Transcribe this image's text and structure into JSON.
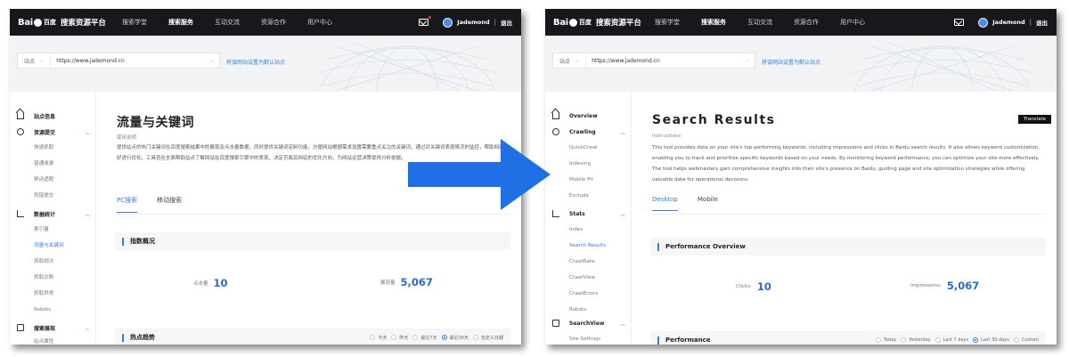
{
  "colors": {
    "topbar": "#18181c",
    "accent": "#3b7ddd",
    "arrow": "#1f6fe5",
    "metric": "#2a6ac9"
  },
  "cn": {
    "logo": "Bai",
    "logo_suffix": "百度",
    "platform": "搜索资源平台",
    "topnav": [
      "搜索学堂",
      "搜索服务",
      "互动交流",
      "资源合作",
      "用户中心"
    ],
    "active_nav": 1,
    "user": "Jademond",
    "logout": "退出",
    "site_prefix": "站点",
    "site_url": "https://www.jademond.cn",
    "set_default": "将该网站设置为默认站点",
    "sidebar": {
      "overview": "站点信息",
      "crawl_group": "资源提交",
      "crawl_items": [
        "快速抓取",
        "普通收录",
        "移动适配",
        "死链提交"
      ],
      "stats_group": "数据统计",
      "stats_items": [
        "索引量",
        "流量与关键词",
        "抓取频次",
        "抓取诊断",
        "抓取异常",
        "Robots"
      ],
      "view_group": "搜索展现",
      "view_items": [
        "站点属性"
      ]
    },
    "title": "流量与关键词",
    "instr_title": "使用说明",
    "instr_text": "提供站点的热门关键词在百度搜索结果中的展现及点击量数据，同时提供关键词定制功能，方便网站根据需求设置需要重点关注的关键词，通过对关键词表现情况的监控，帮助网站更好进行优化。工具旨在全面帮助站点了解网站在百度搜索引擎中的表现，决定页面及网站的优化方向，为网站运营决策提供分析依据。",
    "tabs": [
      "PC搜索",
      "移动搜索"
    ],
    "overview_title": "指数概况",
    "clicks_label": "点击量",
    "clicks_value": "10",
    "impr_label": "展现量",
    "impr_value": "5,067",
    "perf_title": "热点趋势",
    "ranges": [
      "今天",
      "昨天",
      "最近7天",
      "最近30天",
      "自定义日期"
    ],
    "range_selected": 3
  },
  "en": {
    "logo": "Bai",
    "logo_suffix": "百度",
    "platform": "搜索资源平台",
    "topnav": [
      "搜索学堂",
      "搜索服务",
      "互动交流",
      "资源合作",
      "用户中心"
    ],
    "active_nav": 1,
    "user": "Jademond",
    "logout": "退出",
    "site_prefix": "站点",
    "site_url": "https://www.jademond.cn",
    "set_default": "将该网站设置为默认站点",
    "translate": "Translate",
    "sidebar": {
      "overview": "Overview",
      "crawl_group": "Crawling",
      "crawl_items": [
        "QuickCrawl",
        "Indexing",
        "Mobile Fit",
        "Exclude"
      ],
      "stats_group": "Stats",
      "stats_items": [
        "Index",
        "Search Results",
        "CrawlRate",
        "CrawlView",
        "CrawlErrors",
        "Robots"
      ],
      "view_group": "SearchView",
      "view_items": [
        "Site Settings"
      ]
    },
    "title": "Search Results",
    "instr_title": "Instructions",
    "instr_text": "This tool provides data on your site's top-performing keywords, including impressions and clicks in Baidu search results. It also allows keyword customization, enabling you to track and prioritize specific keywords based on your needs. By monitoring keyword performance, you can optimize your site more effectively. The tool helps webmasters gain comprehensive insights into their site's presence on Baidu, guiding page and site optimization strategies while offering valuable data for operational decisions.",
    "tabs": [
      "Desktop",
      "Mobile"
    ],
    "overview_title": "Performance Overview",
    "clicks_label": "Clicks:",
    "clicks_value": "10",
    "impr_label": "Impressions:",
    "impr_value": "5,067",
    "perf_title": "Performance",
    "ranges": [
      "Today",
      "Yesterday",
      "Last 7 days",
      "Last 30 days",
      "Custom"
    ],
    "range_selected": 3
  }
}
